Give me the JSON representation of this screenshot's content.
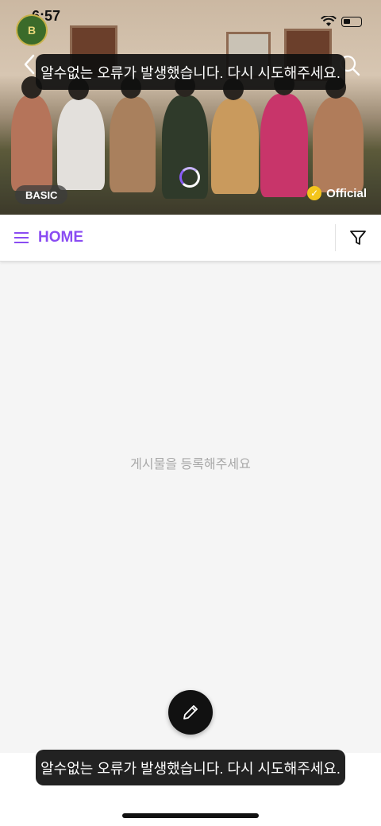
{
  "status": {
    "time": "6:57"
  },
  "header": {
    "club_logo": "club-logo-emblem",
    "club_logo_text": "B",
    "back_icon": "chevron-left-icon",
    "search_icon": "search-icon"
  },
  "hero": {
    "badge": "BASIC",
    "official_label": "Official"
  },
  "toast": {
    "message": "알수없는 오류가 발생했습니다. 다시 시도해주세요."
  },
  "tabs": {
    "home_label": "HOME",
    "filter_icon": "filter-icon"
  },
  "main": {
    "empty_message": "게시물을 등록해주세요"
  },
  "fab": {
    "icon": "pencil-icon"
  },
  "colors": {
    "accent": "#8a4cf2",
    "official_check": "#f4c51c",
    "toast_bg": "#0f0f0f",
    "content_bg": "#f5f5f5"
  }
}
